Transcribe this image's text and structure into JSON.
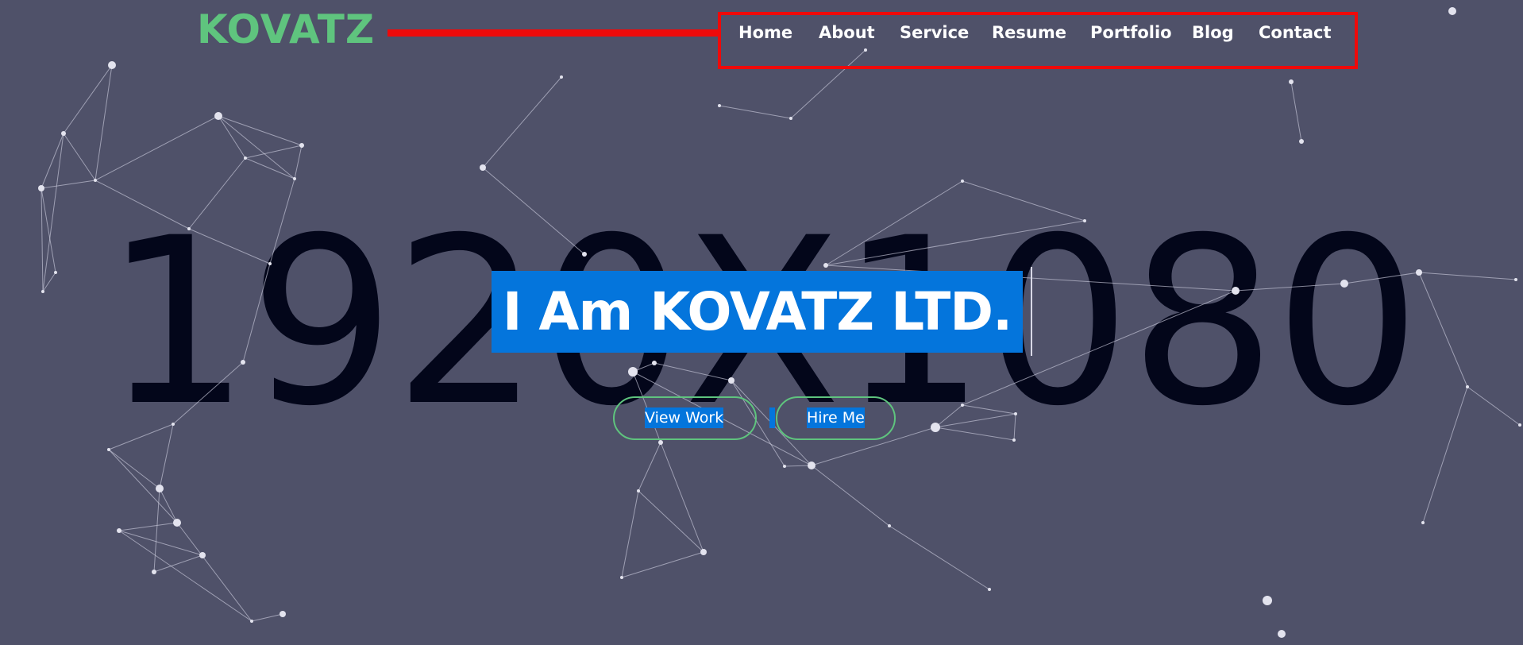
{
  "brand": {
    "logo": "KOVATZ",
    "accent_color": "#5fc47e",
    "highlight_color": "#ee0a0a",
    "selection_color": "#0475dc"
  },
  "nav": {
    "items": [
      "Home",
      "About",
      "Service",
      "Resume",
      "Portfolio",
      "Blog",
      "Contact"
    ]
  },
  "hero": {
    "placeholder_text": "1920X1080",
    "headline": "I Am KOVATZ LTD.",
    "buttons": {
      "view_work": "View Work",
      "hire_me": "Hire Me"
    }
  }
}
